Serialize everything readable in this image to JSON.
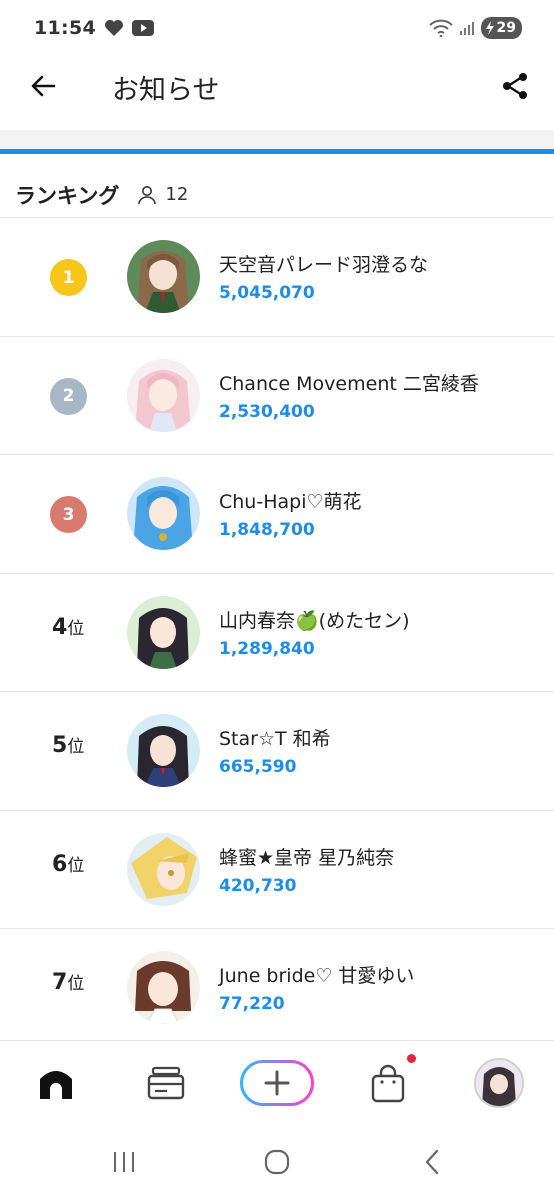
{
  "status_bar": {
    "time": "11:54",
    "battery": "29"
  },
  "app_bar": {
    "title": "お知らせ"
  },
  "section": {
    "title": "ランキング",
    "member_count": "12"
  },
  "colors": {
    "accent": "#1e8ce8",
    "gold": "#f5c400",
    "silver": "#a9b6c4",
    "bronze": "#d97a6e",
    "notify": "#e8253f"
  },
  "ranking": [
    {
      "rank": "1",
      "name": "天空音パレード羽澄るな",
      "score": "5,045,070"
    },
    {
      "rank": "2",
      "name": "Chance Movement 二宮綾香",
      "score": "2,530,400"
    },
    {
      "rank": "3",
      "name": "Chu-Hapi♡萌花",
      "score": "1,848,700"
    },
    {
      "rank": "4",
      "rank_suffix": "位",
      "name": "山内春奈🍏(めたセン)",
      "score": "1,289,840"
    },
    {
      "rank": "5",
      "rank_suffix": "位",
      "name": "Star☆T 和希",
      "score": "665,590"
    },
    {
      "rank": "6",
      "rank_suffix": "位",
      "name": "蜂蜜★皇帝 星乃純奈",
      "score": "420,730"
    },
    {
      "rank": "7",
      "rank_suffix": "位",
      "name": "June bride♡ 甘愛ゆい",
      "score": "77,220"
    }
  ],
  "bottom_nav": {
    "items": [
      "home-icon",
      "tickets-icon",
      "plus-icon",
      "shop-bag-icon",
      "profile-avatar"
    ]
  }
}
